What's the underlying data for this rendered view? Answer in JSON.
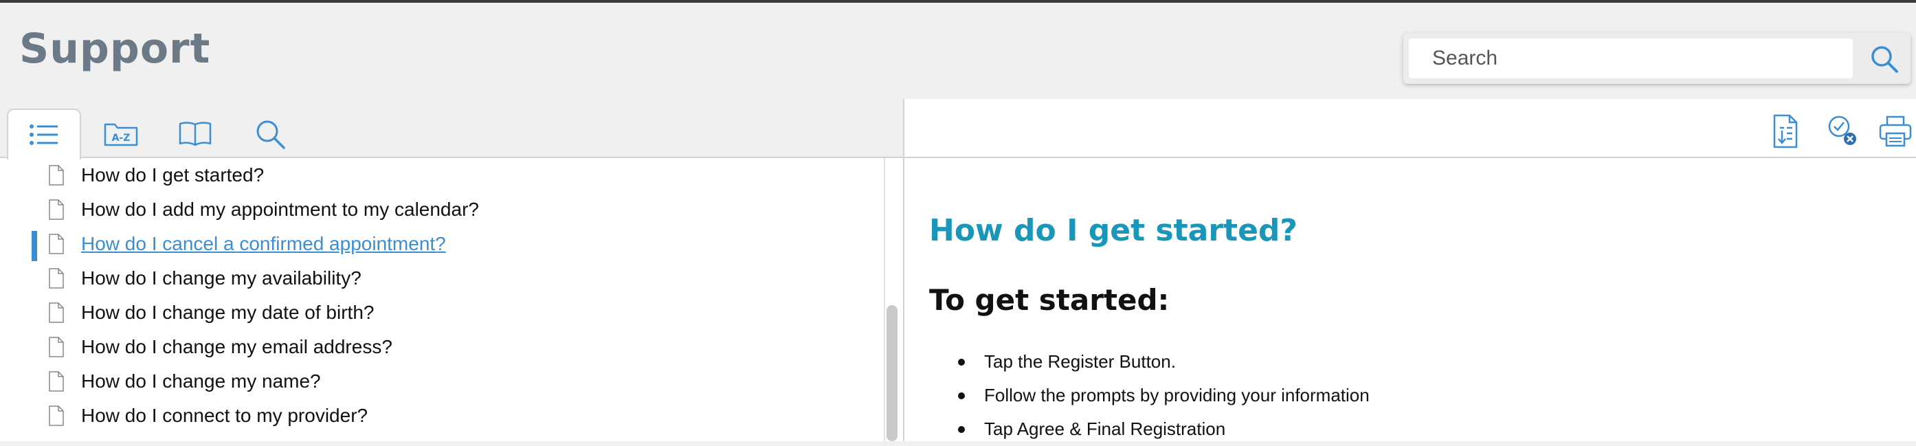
{
  "header": {
    "title": "Support",
    "search_placeholder": "Search"
  },
  "nav_tabs": [
    {
      "name": "contents",
      "icon": "list-icon",
      "active": true
    },
    {
      "name": "index",
      "icon": "a-z-folder-icon",
      "active": false
    },
    {
      "name": "glossary",
      "icon": "open-book-icon",
      "active": false
    },
    {
      "name": "search",
      "icon": "search-icon",
      "active": false
    }
  ],
  "toc": {
    "items": [
      {
        "label": "How do I get started?"
      },
      {
        "label": "How do I add my appointment to my calendar?"
      },
      {
        "label": "How do I cancel a confirmed appointment?",
        "selected": true
      },
      {
        "label": "How do I change my availability?"
      },
      {
        "label": "How do I change my date of birth?"
      },
      {
        "label": "How do I change my email address?"
      },
      {
        "label": "How do I change my name?"
      },
      {
        "label": "How do I connect to my provider?"
      }
    ]
  },
  "toolbar": {
    "icons": [
      "expand-all-icon",
      "remove-highlight-icon",
      "print-icon"
    ]
  },
  "content": {
    "title": "How do I get started?",
    "heading": "To get started:",
    "bullets": [
      "Tap the Register Button.",
      "Follow the prompts by providing your information",
      "Tap Agree & Final Registration"
    ]
  },
  "colors": {
    "accent": "#3a8ed4",
    "title_teal": "#1a97b8",
    "header_text": "#6b7a86",
    "background": "#f0f0f0"
  }
}
